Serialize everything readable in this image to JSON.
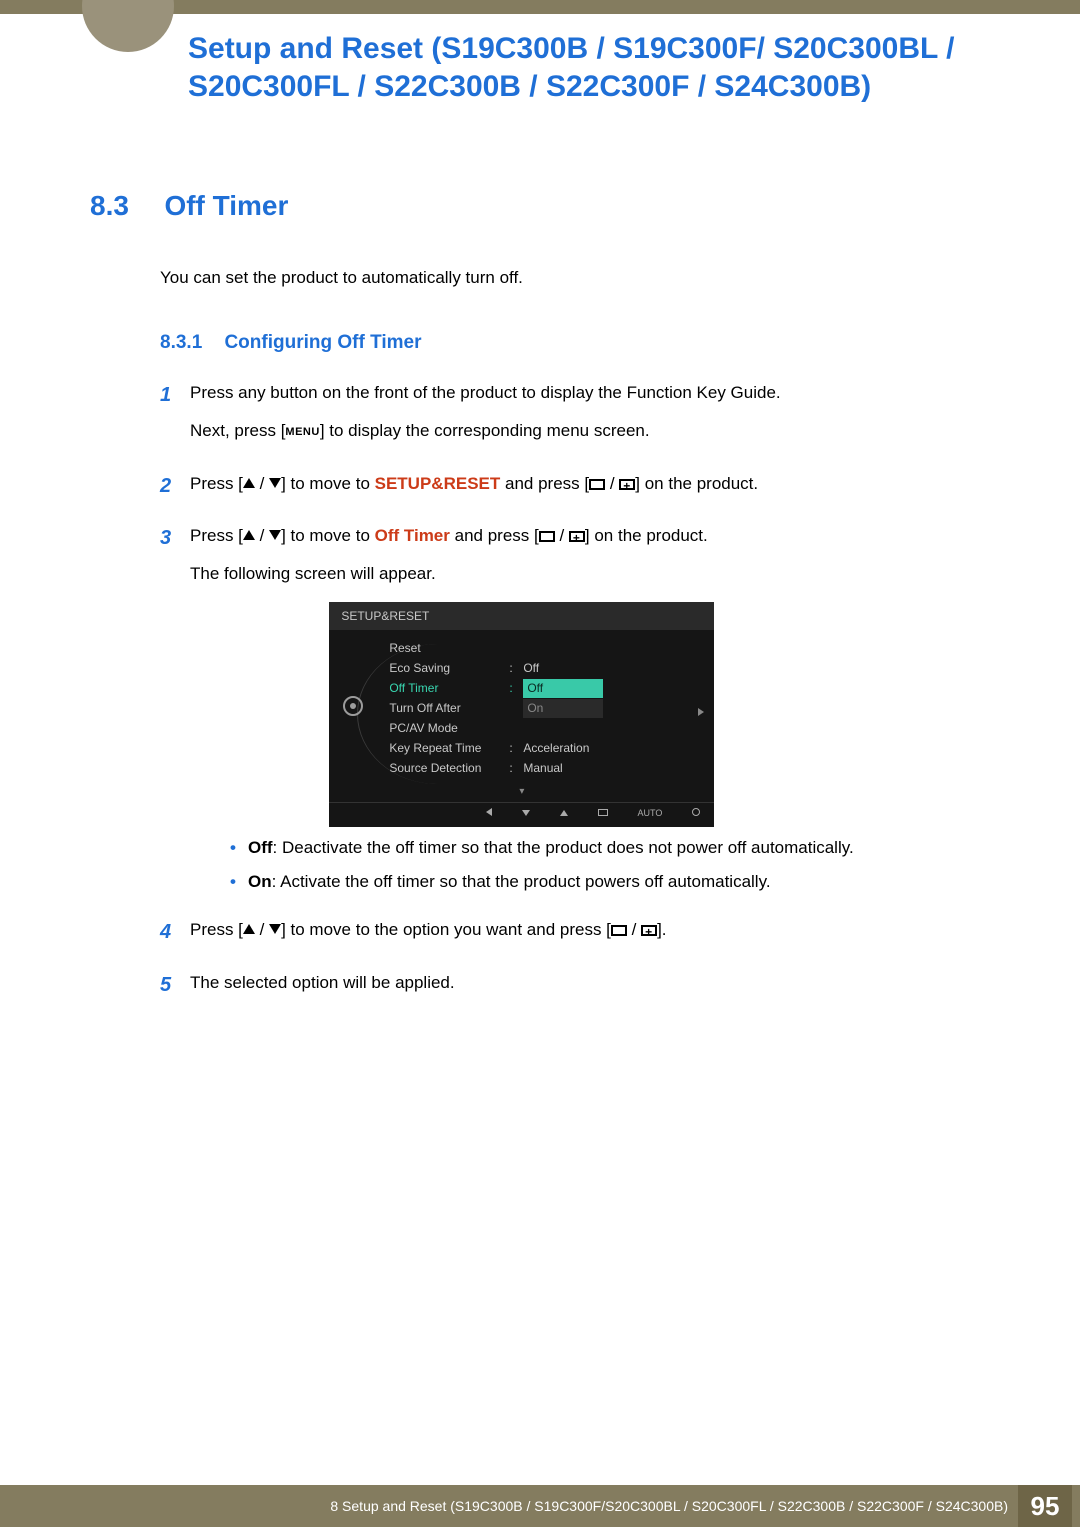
{
  "chapter_title": "Setup and Reset (S19C300B / S19C300F/ S20C300BL / S20C300FL / S22C300B / S22C300F / S24C300B)",
  "section": {
    "num": "8.3",
    "title": "Off Timer"
  },
  "intro": "You can set the product to automatically turn off.",
  "subsection": {
    "num": "8.3.1",
    "title": "Configuring Off Timer"
  },
  "steps": {
    "s1a": "Press any button on the front of the product to display the Function Key Guide.",
    "s1b_pre": "Next, press [",
    "s1b_menu": "MENU",
    "s1b_post": "] to display the corresponding menu screen.",
    "s2_pre": "Press [",
    "s2_mid": "] to move to ",
    "s2_kw": "SETUP&RESET",
    "s2_post1": " and press [",
    "s2_post2": "] on the product.",
    "s3_pre": "Press [",
    "s3_mid": "] to move to ",
    "s3_kw": "Off Timer",
    "s3_post1": " and press [",
    "s3_post2": "] on the product.",
    "s3_tail": "The following screen will appear.",
    "s4_pre": "Press [",
    "s4_mid": "] to move to the option you want and press [",
    "s4_post": "].",
    "s5": "The selected option will be applied."
  },
  "osd": {
    "title": "SETUP&RESET",
    "items": [
      {
        "label": "Reset",
        "value": ""
      },
      {
        "label": "Eco Saving",
        "value": "Off"
      },
      {
        "label": "Off Timer",
        "value": "Off",
        "selected": true,
        "option2": "On"
      },
      {
        "label": "Turn Off After",
        "value": ""
      },
      {
        "label": "PC/AV Mode",
        "value": ""
      },
      {
        "label": "Key Repeat Time",
        "value": "Acceleration"
      },
      {
        "label": "Source Detection",
        "value": "Manual"
      }
    ],
    "auto": "AUTO"
  },
  "bullets": {
    "off_label": "Off",
    "off_text": ": Deactivate the off timer so that the product does not power off automatically.",
    "on_label": "On",
    "on_text": ": Activate the off timer so that the product powers off automatically."
  },
  "footer": {
    "text": "8 Setup and Reset (S19C300B / S19C300F/S20C300BL / S20C300FL / S22C300B / S22C300F / S24C300B)",
    "page": "95"
  }
}
